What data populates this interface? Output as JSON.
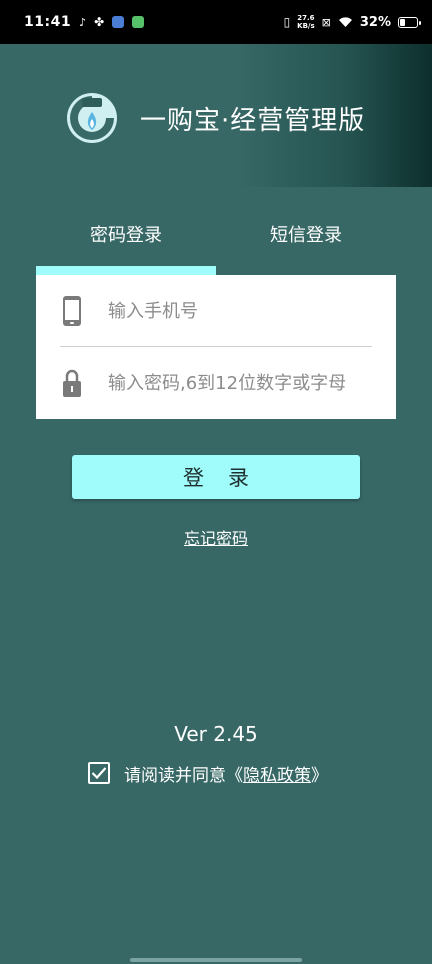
{
  "status_bar": {
    "time": "11:41",
    "net_speed_value": "27.6",
    "net_speed_unit": "KB/s",
    "battery": "32%",
    "battery_level": 0.32,
    "icons": [
      "tiktok-icon",
      "pinwheel-icon",
      "app-icon",
      "app-icon",
      "vibrate-icon",
      "sim-off-icon",
      "wifi-icon",
      "battery-icon"
    ]
  },
  "header": {
    "app_title": "一购宝·经营管理版",
    "logo": "logo-icon",
    "gradient_colors": [
      "#376866",
      "#0d2f2d"
    ]
  },
  "tabs": [
    {
      "label": "密码登录",
      "active": true
    },
    {
      "label": "短信登录",
      "active": false
    }
  ],
  "form": {
    "phone_placeholder": "输入手机号",
    "phone_value": "",
    "password_placeholder": "输入密码,6到12位数字或字母",
    "password_value": ""
  },
  "login_button_label": "登录",
  "forgot_password_label": "忘记密码",
  "version_text": "Ver 2.45",
  "agreement": {
    "checked": true,
    "prefix": "请阅读并同意《",
    "link": "隐私政策",
    "suffix": "》"
  },
  "colors": {
    "background": "#376866",
    "accent": "#9ffcfb",
    "card": "#ffffff"
  }
}
